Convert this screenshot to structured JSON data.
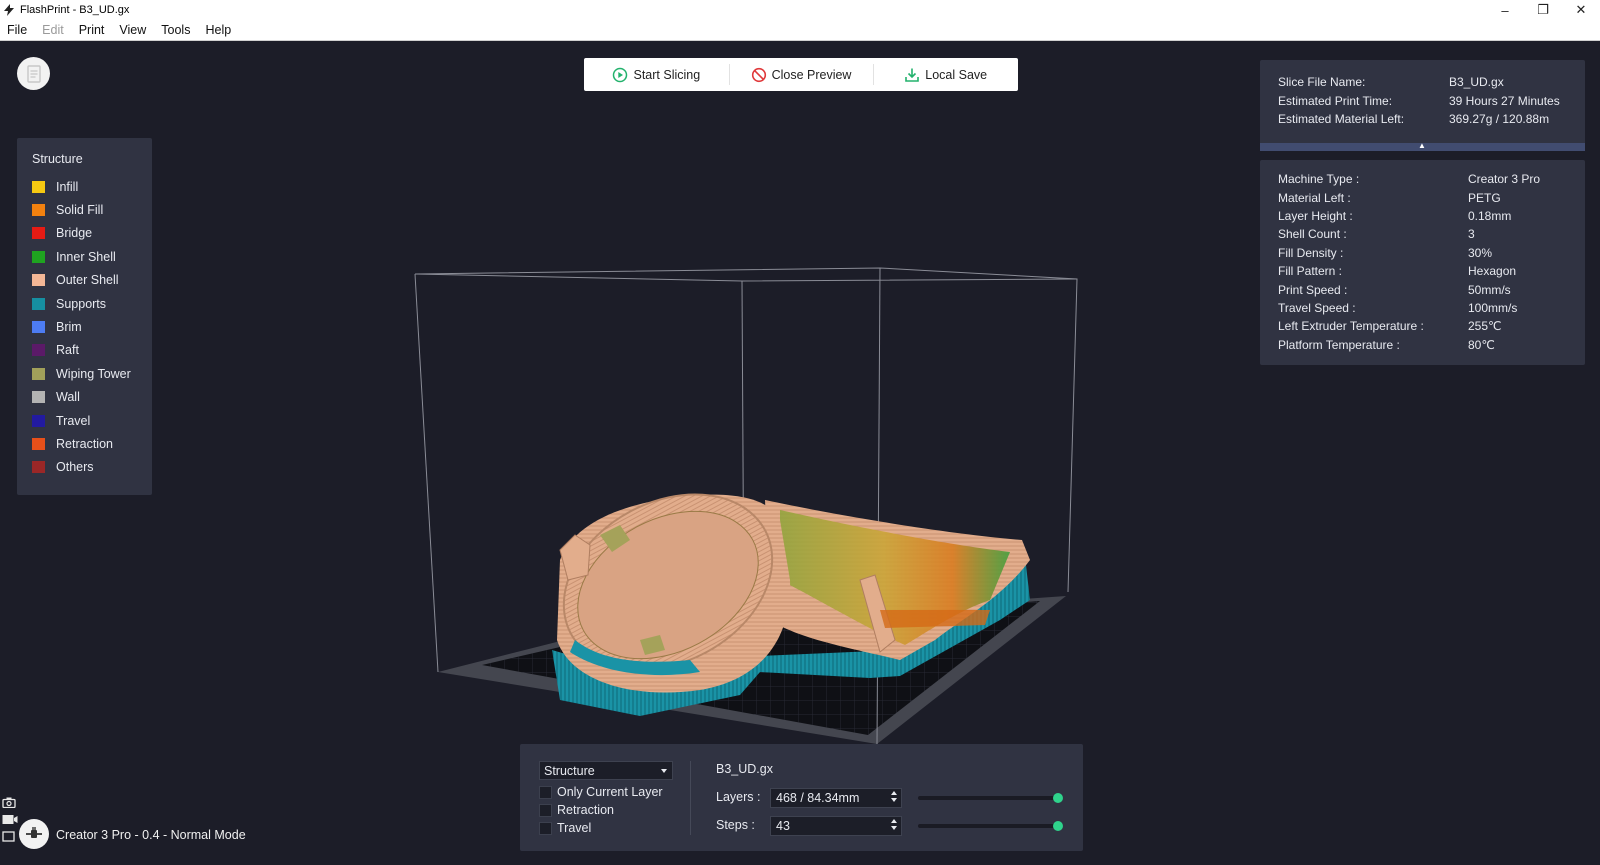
{
  "window": {
    "title": "FlashPrint - B3_UD.gx",
    "minimize": "–",
    "restore": "❐",
    "close": "✕"
  },
  "menu": [
    {
      "label": "File",
      "disabled": false
    },
    {
      "label": "Edit",
      "disabled": true
    },
    {
      "label": "Print",
      "disabled": false
    },
    {
      "label": "View",
      "disabled": false
    },
    {
      "label": "Tools",
      "disabled": false
    },
    {
      "label": "Help",
      "disabled": false
    }
  ],
  "toolbar": {
    "start_slicing": "Start Slicing",
    "close_preview": "Close Preview",
    "local_save": "Local Save"
  },
  "legend": {
    "title": "Structure",
    "items": [
      {
        "label": "Infill",
        "color": "#f6c912"
      },
      {
        "label": "Solid Fill",
        "color": "#f2810f"
      },
      {
        "label": "Bridge",
        "color": "#e51b14"
      },
      {
        "label": "Inner Shell",
        "color": "#1fa320"
      },
      {
        "label": "Outer Shell",
        "color": "#f4b796"
      },
      {
        "label": "Supports",
        "color": "#168fa1"
      },
      {
        "label": "Brim",
        "color": "#4d7cf2"
      },
      {
        "label": "Raft",
        "color": "#5b1a68"
      },
      {
        "label": "Wiping Tower",
        "color": "#a1a05a"
      },
      {
        "label": "Wall",
        "color": "#b3b3b3"
      },
      {
        "label": "Travel",
        "color": "#221aa0"
      },
      {
        "label": "Retraction",
        "color": "#e7501a"
      },
      {
        "label": "Others",
        "color": "#9a2727"
      }
    ]
  },
  "slice_info": [
    {
      "key": "Slice File Name:",
      "value": "B3_UD.gx"
    },
    {
      "key": "Estimated Print Time:",
      "value": "39 Hours 27 Minutes"
    },
    {
      "key": "Estimated Material Left:",
      "value": "369.27g / 120.88m"
    }
  ],
  "machine_info": [
    {
      "key": "Machine Type :",
      "value": "Creator 3 Pro"
    },
    {
      "key": "Material Left :",
      "value": "PETG"
    },
    {
      "key": "Layer Height :",
      "value": "0.18mm"
    },
    {
      "key": "Shell Count :",
      "value": "3"
    },
    {
      "key": "Fill Density :",
      "value": "30%"
    },
    {
      "key": "Fill Pattern :",
      "value": "Hexagon"
    },
    {
      "key": "Print Speed :",
      "value": "50mm/s"
    },
    {
      "key": "Travel Speed :",
      "value": "100mm/s"
    },
    {
      "key": "Left Extruder Temperature :",
      "value": "255℃"
    },
    {
      "key": "Platform Temperature :",
      "value": "80℃"
    }
  ],
  "preview_panel": {
    "mode_select": "Structure",
    "checkboxes": [
      "Only Current Layer",
      "Retraction",
      "Travel"
    ],
    "file_name": "B3_UD.gx",
    "layers_label": "Layers :",
    "layers_value": "468 / 84.34mm",
    "layers_slider_fraction": 1.0,
    "steps_label": "Steps :",
    "steps_value": "43",
    "steps_slider_fraction": 1.0
  },
  "status": {
    "machine": "Creator 3 Pro - 0.4 - Normal Mode"
  },
  "icons": {
    "document": "document-icon",
    "camera": "camera-icon",
    "video": "video-icon",
    "machine": "plug-icon"
  }
}
